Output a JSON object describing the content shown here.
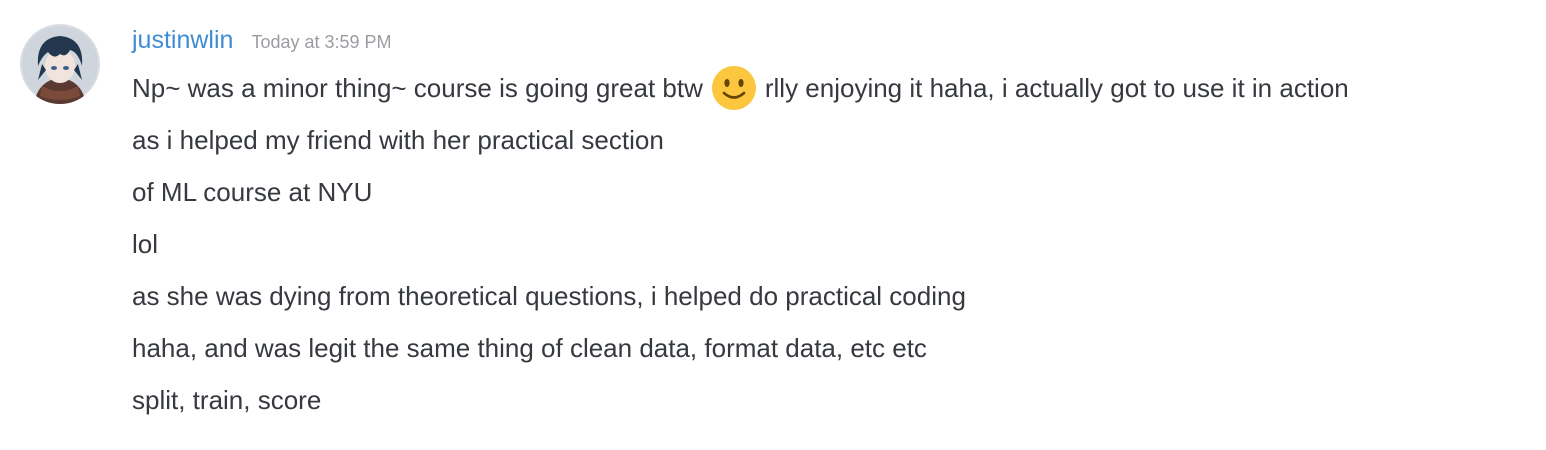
{
  "message": {
    "author": "justinwlin",
    "timestamp": "Today at 3:59 PM",
    "avatar_icon": "anime-avatar",
    "emoji": "slightly-smiling-face",
    "line1_before_emoji": "Np~ was a minor thing~ course is going great btw",
    "line1_after_emoji": "rlly enjoying it haha, i actually got to use it in action",
    "lines": [
      "as i helped my friend with her practical section",
      "of ML course at NYU",
      "lol",
      "as she was dying from theoretical questions, i helped do practical coding",
      "haha, and was legit the same thing of clean data, format data, etc etc",
      "split, train, score"
    ]
  }
}
